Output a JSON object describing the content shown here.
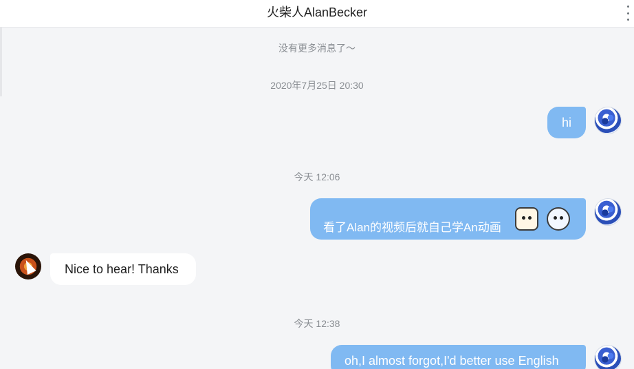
{
  "header": {
    "title": "火柴人AlanBecker"
  },
  "system": {
    "no_more": "没有更多消息了～"
  },
  "timestamps": [
    "2020年7月25日 20:30",
    "今天 12:06",
    "今天 12:38"
  ],
  "messages": [
    {
      "from": "self",
      "text": "hi"
    },
    {
      "from": "self",
      "text": "看了Alan的视频后就自己学An动画",
      "emotes": [
        "doge-emote",
        "cry-emote"
      ]
    },
    {
      "from": "other",
      "text": "Nice to hear! Thanks"
    },
    {
      "from": "self",
      "text": "oh,I almost forgot,I'd better use English"
    }
  ],
  "colors": {
    "self_bubble": "#80b9f2",
    "other_bubble": "#ffffff",
    "background": "#f4f5f7"
  }
}
